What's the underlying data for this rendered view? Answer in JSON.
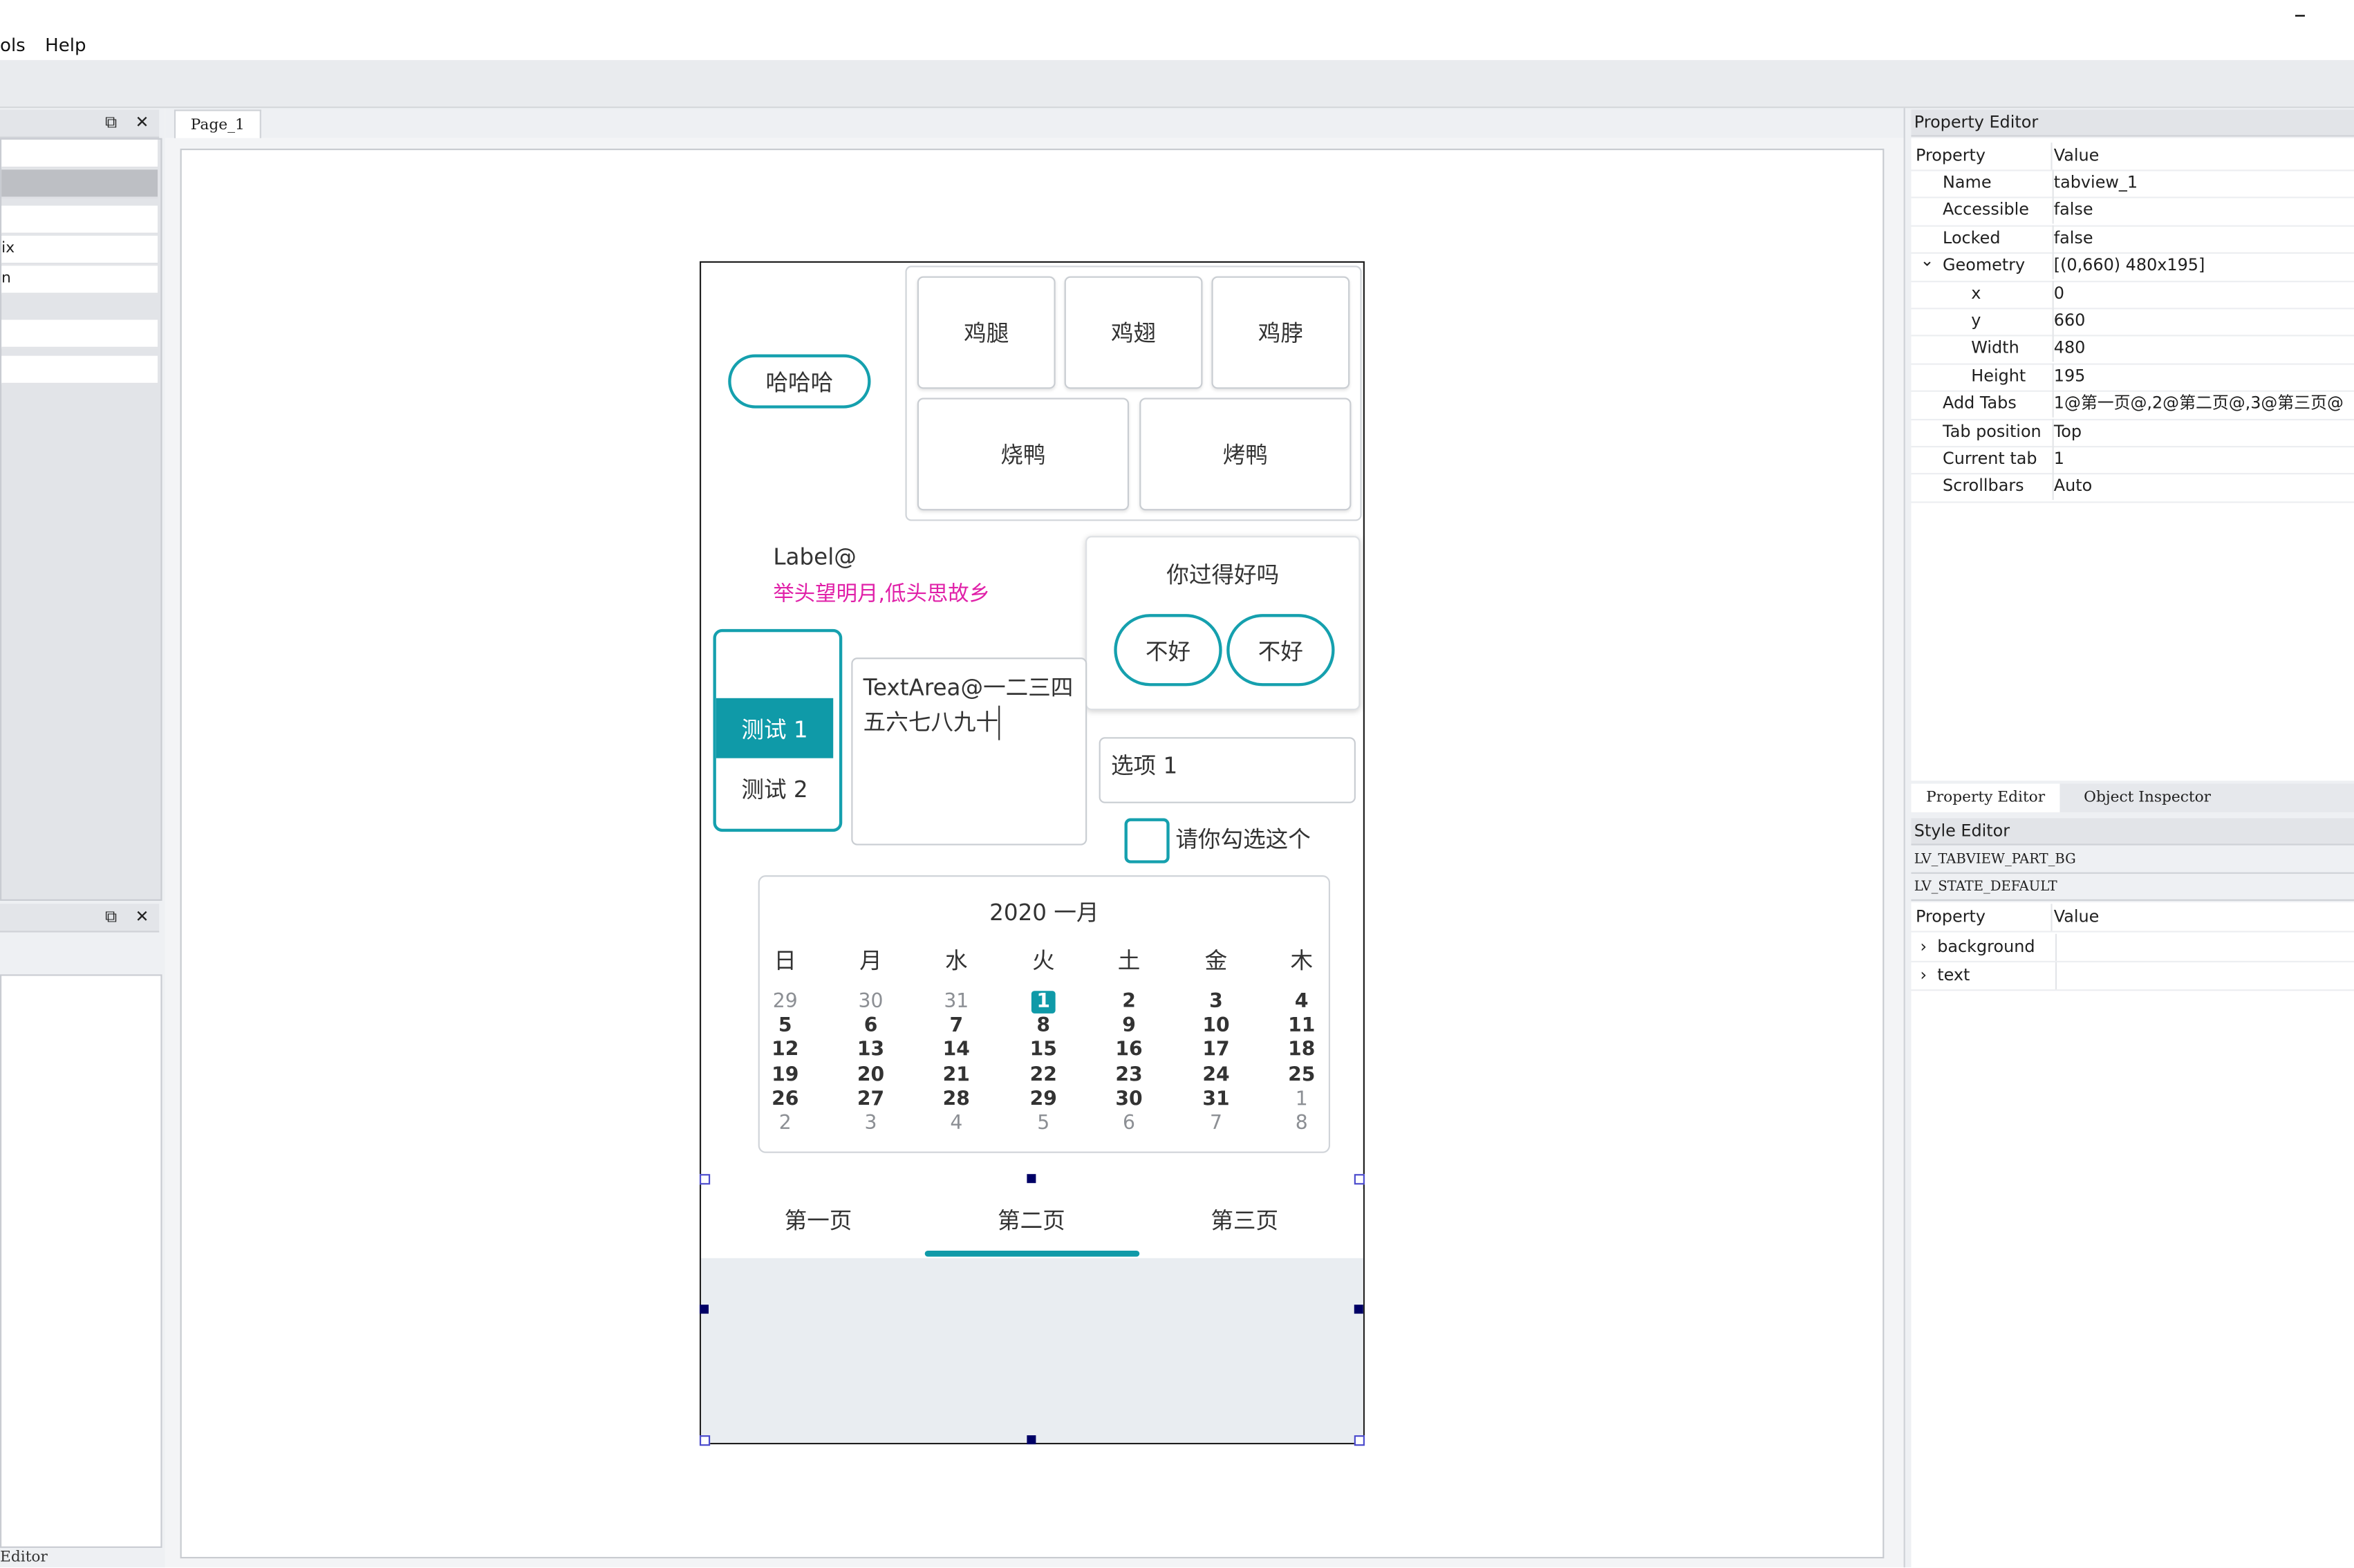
{
  "menubar": {
    "items": [
      "ols",
      "Help"
    ],
    "minimize": "–"
  },
  "left": {
    "panel1_rows": [
      "",
      "",
      "",
      "ix",
      "n",
      ""
    ],
    "panel2_title": "",
    "footer": "Editor"
  },
  "center": {
    "page_tab": "Page_1",
    "widgets": {
      "round_button": "哈哈哈",
      "matrix": [
        "鸡腿",
        "鸡翅",
        "鸡脖",
        "烧鸭",
        "烤鸭"
      ],
      "label_line1": "Label@",
      "label_line2": "举头望明月,低头思故乡",
      "msgbox_title": "你过得好吗",
      "msgbox_btn1": "不好",
      "msgbox_btn2": "不好",
      "roller": [
        "测试 1",
        "测试 2"
      ],
      "textarea_line1": "TextArea@一二三四",
      "textarea_line2": "五六七八九十",
      "dropdown": "选项 1",
      "checkbox_label": "请你勾选这个",
      "calendar": {
        "header": "2020 一月",
        "day_names": [
          "日",
          "月",
          "水",
          "火",
          "土",
          "金",
          "木"
        ],
        "weeks": [
          [
            "29",
            "30",
            "31",
            "1",
            "2",
            "3",
            "4"
          ],
          [
            "5",
            "6",
            "7",
            "8",
            "9",
            "10",
            "11"
          ],
          [
            "12",
            "13",
            "14",
            "15",
            "16",
            "17",
            "18"
          ],
          [
            "19",
            "20",
            "21",
            "22",
            "23",
            "24",
            "25"
          ],
          [
            "26",
            "27",
            "28",
            "29",
            "30",
            "31",
            "1"
          ],
          [
            "2",
            "3",
            "4",
            "5",
            "6",
            "7",
            "8"
          ]
        ],
        "today": "1"
      },
      "tabview": {
        "tabs": [
          "第一页",
          "第二页",
          "第三页"
        ],
        "active": 1
      }
    }
  },
  "right": {
    "property_editor": {
      "title": "Property Editor",
      "col_property": "Property",
      "col_value": "Value",
      "rows": [
        {
          "name": "Name",
          "value": "tabview_1",
          "indent": 1
        },
        {
          "name": "Accessible",
          "value": "false",
          "indent": 1
        },
        {
          "name": "Locked",
          "value": "false",
          "indent": 1
        },
        {
          "name": "Geometry",
          "value": "[(0,660) 480x195]",
          "indent": 1,
          "expanded": true
        },
        {
          "name": "x",
          "value": "0",
          "indent": 2
        },
        {
          "name": "y",
          "value": "660",
          "indent": 2
        },
        {
          "name": "Width",
          "value": "480",
          "indent": 2
        },
        {
          "name": "Height",
          "value": "195",
          "indent": 2
        },
        {
          "name": "Add Tabs",
          "value": "1@第一页@,2@第二页@,3@第三页@",
          "indent": 1
        },
        {
          "name": "Tab position",
          "value": "Top",
          "indent": 1
        },
        {
          "name": "Current tab",
          "value": "1",
          "indent": 1
        },
        {
          "name": "Scrollbars",
          "value": "Auto",
          "indent": 1
        }
      ],
      "tabs": [
        "Property Editor",
        "Object Inspector"
      ]
    },
    "style_editor": {
      "title": "Style Editor",
      "part": "LV_TABVIEW_PART_BG",
      "state": "LV_STATE_DEFAULT",
      "col_property": "Property",
      "col_value": "Value",
      "rows": [
        {
          "name": "background"
        },
        {
          "name": "text"
        }
      ]
    }
  },
  "colors": {
    "accent": "#0f9aa8",
    "label_pink": "#e020a8"
  }
}
